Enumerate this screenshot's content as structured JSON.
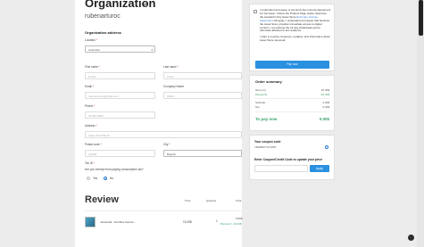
{
  "organization": {
    "title": "Organization",
    "name": "rubenarturoc"
  },
  "address": {
    "section_title": "Organization address",
    "location_label": "Location",
    "location_value": "Colombia",
    "first_name_label": "First name",
    "first_name_placeholder": "Rubén",
    "last_name_label": "Last name",
    "last_name_placeholder": "Arturo",
    "email_label": "Email",
    "email_placeholder": "rubenarturoc@gmail.com",
    "company_label": "Company Name",
    "company_placeholder": "ARRA",
    "phone_label": "Phone",
    "phone_placeholder": "3013974820",
    "address_label": "Address",
    "address_placeholder": "Calle 150 # 55-33",
    "postal_label": "Postal code",
    "postal_placeholder": "111156",
    "city_label": "City",
    "city_value": "Bogotá",
    "tax_label": "Tax ID",
    "exempt_question": "Are you exempt from paying consumption tax?",
    "yes_label": "Yes",
    "no_label": "No",
    "required_mark": "*"
  },
  "review": {
    "title": "Review",
    "col_price": "Price",
    "col_quantity": "Quantity",
    "col_total": "Total",
    "item": {
      "name": "Essential - Zombies Games -",
      "price": "10,40$",
      "quantity": "1",
      "total": "0.00$",
      "discount": "Discount: -10.40$"
    }
  },
  "terms": {
    "text_before": "I understand and agree to the End User License Agreement for this Asset. Unless the Product Page states otherwise, the standard Unity Asset Store ",
    "link": "End User License Agreement",
    "text_after": " will apply. I understand and agree that because the Asset Store provides immediate access to digital content, I am waiving the 14-day withdrawal period otherwise afforded to EU residents.",
    "promo_text": "I want to receive resources, updates, and information about Asset Store via email.",
    "pay_button": "Pay now"
  },
  "order_summary": {
    "title": "Order summary",
    "items_label": "Items (1)",
    "items_value": "10.40$",
    "discount_label": "Discounts",
    "discount_value": "-10.40$",
    "subtotal_label": "Subtotal",
    "subtotal_value": "0.00$",
    "tax_label": "Tax",
    "tax_value": "0.00$",
    "to_pay_label": "To pay now",
    "to_pay_value": "0.00$"
  },
  "coupon": {
    "title": "Your coupon code",
    "code": "74E80E77471295",
    "credit_title": "Enter Coupon/Credit Code to update your price",
    "apply_button": "Apply"
  },
  "colors": {
    "accent": "#2a90e0",
    "success": "#38a169",
    "page_bg": "#ececec"
  }
}
